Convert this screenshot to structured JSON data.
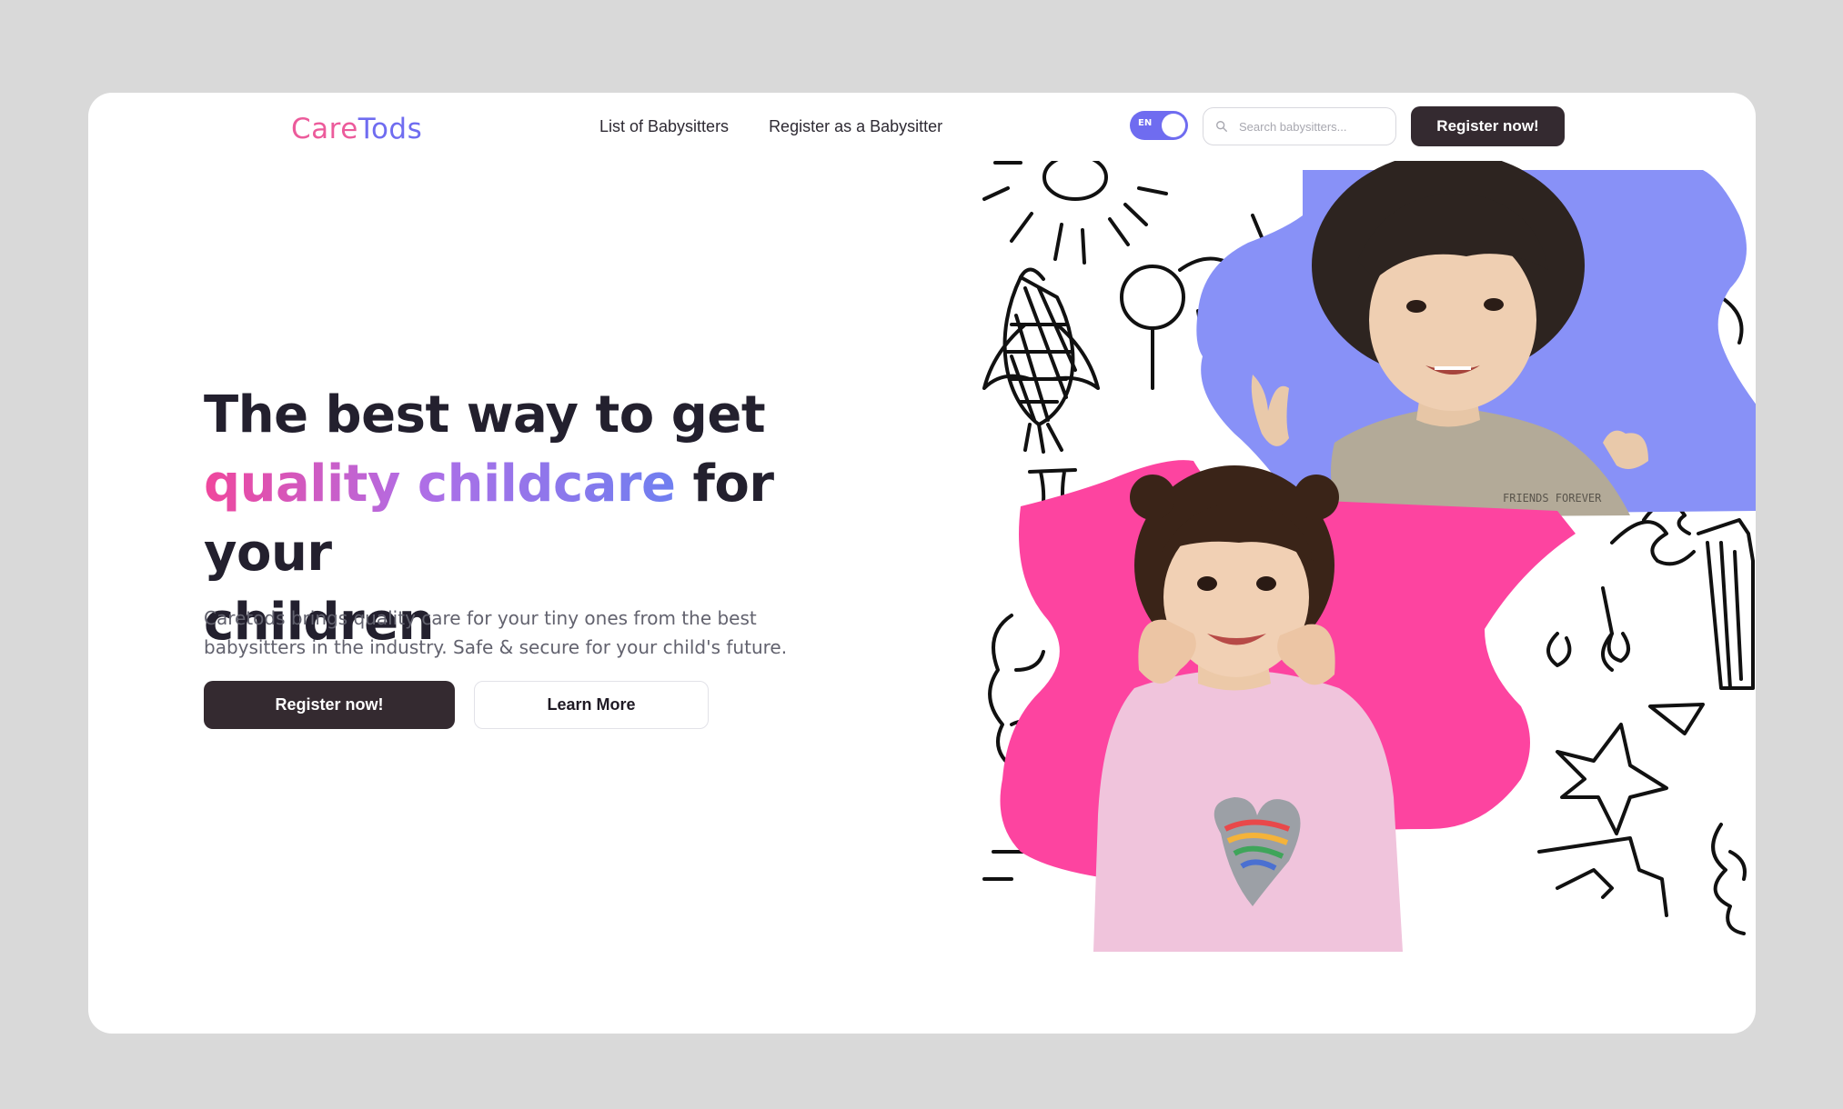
{
  "brand": {
    "name_part1": "Care",
    "name_part2": "Tods"
  },
  "nav": [
    {
      "label": "List of Babysitters"
    },
    {
      "label": "Register as a Babysitter"
    }
  ],
  "language_toggle": {
    "label": "EN",
    "state": "on"
  },
  "search": {
    "placeholder": "Search babysitters..."
  },
  "header": {
    "register_label": "Register now!"
  },
  "hero": {
    "headline_line1": "The best way to get",
    "headline_highlight": "quality childcare",
    "headline_line2_rest": "for your",
    "headline_line3": "children",
    "description": "Caretods brings quality care for your tiny ones from the best babysitters in the industry. Safe & secure for your child's future.",
    "primary_cta": "Register now!",
    "secondary_cta": "Learn More"
  },
  "images": {
    "top_photo_label": "FRIENDS FOREVER"
  },
  "colors": {
    "background": "#d9d9d9",
    "brand_pink": "#ec5b9b",
    "brand_purple": "#6f6cf0",
    "dark_button": "#342a30",
    "blob_blue": "#8891f7",
    "blob_pink": "#fd44a0"
  }
}
